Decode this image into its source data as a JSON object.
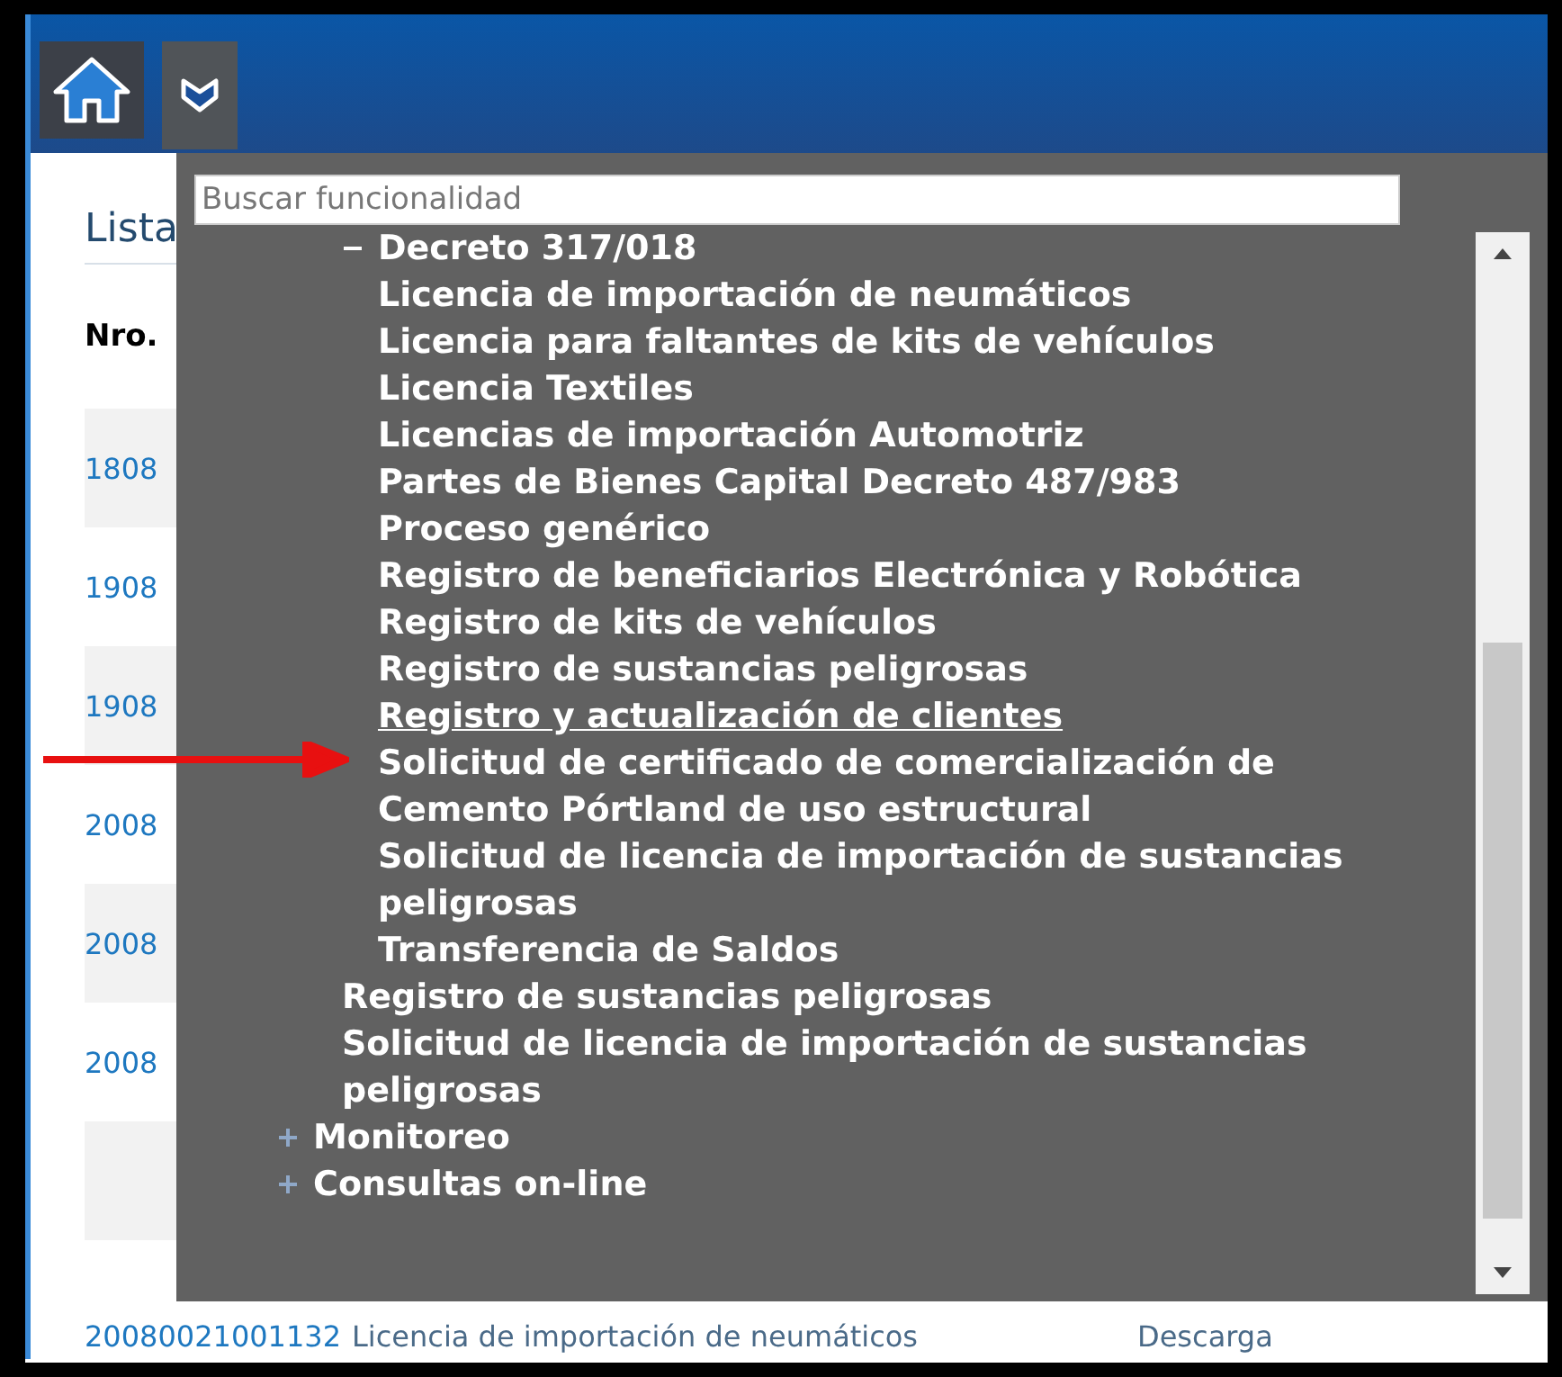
{
  "toolbar": {
    "buttons": [
      {
        "kind": "home"
      },
      {
        "kind": "menu",
        "selected": true
      }
    ]
  },
  "page": {
    "heading": "Lista",
    "columns": [
      "Nro."
    ],
    "rows": [
      {
        "number": "1808",
        "shaded": true
      },
      {
        "number": "1908",
        "shaded": false
      },
      {
        "number": "1908",
        "shaded": true
      },
      {
        "number": "2008",
        "shaded": false
      },
      {
        "number": "2008",
        "shaded": true
      },
      {
        "number": "2008",
        "shaded": false
      },
      {
        "number": "",
        "shaded": true
      }
    ],
    "last_row": {
      "number": "20080021001132",
      "type": "Licencia de importación de neumáticos",
      "task": "Descarga"
    }
  },
  "menu": {
    "search": {
      "placeholder": "Buscar funcionalidad"
    },
    "tree": [
      {
        "children": [
          {
            "label": "Decreto 317/018",
            "expanded": true,
            "selected": false,
            "children": [
              {
                "label": "Licencia de importación de neumáticos",
                "selected": false
              },
              {
                "label": "Licencia para faltantes de kits de vehículos",
                "selected": false
              },
              {
                "label": "Licencia Textiles",
                "selected": false
              },
              {
                "label": "Licencias de importación Automotriz",
                "selected": false
              },
              {
                "label": "Partes de Bienes Capital Decreto 487/983",
                "selected": false
              },
              {
                "label": "Proceso genérico",
                "selected": false
              },
              {
                "label": "Registro de beneficiarios Electrónica y Robótica",
                "selected": false
              },
              {
                "label": "Registro de kits de vehículos",
                "selected": false
              },
              {
                "label": "Registro de sustancias peligrosas",
                "selected": false
              },
              {
                "label": "Registro y actualización de clientes",
                "selected": true
              },
              {
                "label": "Solicitud de certificado de comercialización de Cemento Pórtland de uso estructural",
                "selected": false
              },
              {
                "label": "Solicitud de licencia de importación de sustancias peligrosas",
                "selected": false
              },
              {
                "label": "Transferencia de Saldos",
                "selected": false
              }
            ]
          },
          {
            "label": "Registro de sustancias peligrosas",
            "selected": false
          },
          {
            "label": "Solicitud de licencia de importación de sustancias peligrosas",
            "selected": false
          }
        ]
      },
      {
        "label": "Monitoreo",
        "expanded": false,
        "selected": false
      },
      {
        "label": "Consultas on-line",
        "expanded": false,
        "selected": false
      }
    ]
  },
  "annotation": {
    "kind": "arrow"
  }
}
